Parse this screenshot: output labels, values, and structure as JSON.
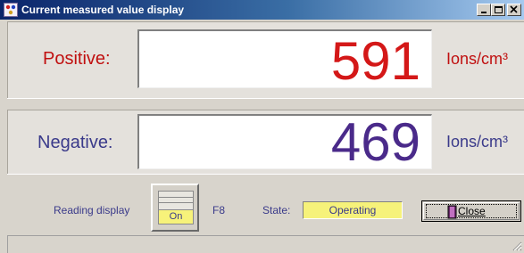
{
  "window": {
    "title": "Current measured value display",
    "icon": "app-icon"
  },
  "titlebar_buttons": {
    "minimize_icon": "minimize-icon",
    "maximize_icon": "maximize-icon",
    "close_icon": "close-x-icon"
  },
  "positive": {
    "label": "Positive:",
    "value": "591",
    "unit": "Ions/cm³",
    "value_color": "#d41818"
  },
  "negative": {
    "label": "Negative:",
    "value": "469",
    "unit": "Ions/cm³",
    "value_color": "#4a2a8a"
  },
  "controls": {
    "reading_display_label": "Reading display",
    "toggle_state": "On",
    "hotkey": "F8",
    "state_label": "State:",
    "state_value": "Operating",
    "close_label_first": "C",
    "close_label_rest": "lose",
    "close_icon": "door-icon"
  },
  "colors": {
    "label_red": "#c01010",
    "label_purple": "#3a3a8a",
    "state_bg": "#f6f27a"
  }
}
